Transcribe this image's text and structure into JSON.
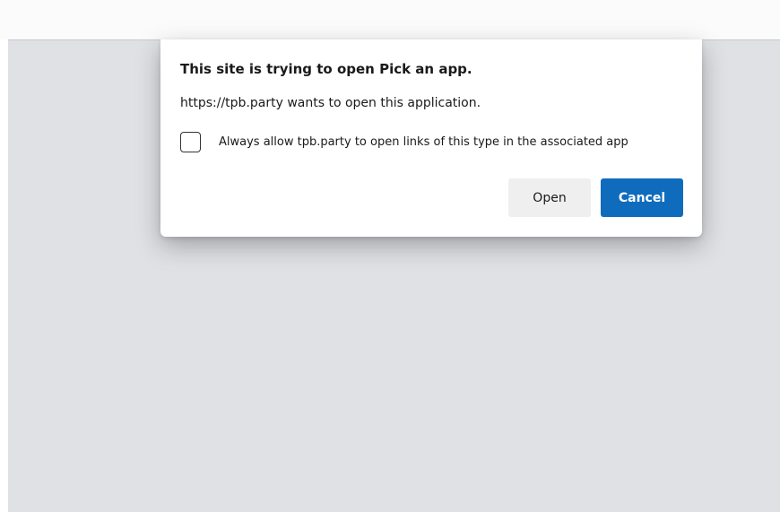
{
  "dialog": {
    "title": "This site is trying to open Pick an app.",
    "message": "https://tpb.party wants to open this application.",
    "checkbox_label": "Always allow tpb.party to open links of this type in the associated app",
    "checkbox_checked": false,
    "open_label": "Open",
    "cancel_label": "Cancel"
  },
  "colors": {
    "primary_button": "#0f6cbd",
    "secondary_button": "#efefef",
    "page_background": "#dfe1e5"
  }
}
